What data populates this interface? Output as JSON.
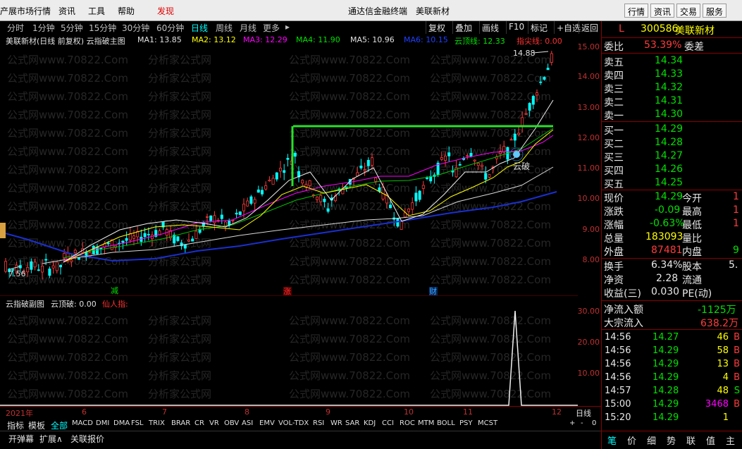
{
  "menubar": {
    "items": [
      "产展市场行情",
      "资讯",
      "工具",
      "帮助",
      "发现"
    ],
    "center_title": "通达信金融终端",
    "center_stock": "美联新材",
    "right_buttons": [
      "行情",
      "资讯",
      "交易",
      "服务"
    ]
  },
  "periods": [
    "分时",
    "1分钟",
    "5分钟",
    "15分钟",
    "30分钟",
    "60分钟",
    "日线",
    "周线",
    "月线",
    "更多"
  ],
  "active_period": "日线",
  "tools": [
    "复权",
    "叠加",
    "画线",
    "F10",
    "标记",
    "+自选",
    "返回"
  ],
  "info": {
    "title": "美联新材(日线 前复权)  云指破主图",
    "ma1": "MA1: 13.85",
    "ma2": "MA2: 13.12",
    "ma3": "MA3: 12.29",
    "ma4": "MA4: 11.90",
    "ma5": "MA5: 10.96",
    "ma6": "MA6: 10.15",
    "cloud": "云顶线: 12.33",
    "tip": "指尖线: 0.00"
  },
  "watermark": [
    "公式网www.70822.Com",
    "分析家公式网",
    "公式网www.70822.Com"
  ],
  "chart_annotations": {
    "high_label": "14.88",
    "low_label": "7.56",
    "cloud_break": "云破",
    "marker_jian": "减",
    "marker_zhang": "涨",
    "marker_cai": "财"
  },
  "yaxis": [
    "15.00",
    "14.00",
    "13.00",
    "12.00",
    "11.00",
    "10.00",
    "9.00",
    "8.00"
  ],
  "sub": {
    "title": "云指破副图",
    "value": "云顶破: 0.00",
    "fairy": "仙人指:"
  },
  "sub_yaxis": [
    "30.00",
    "20.00",
    "10.00"
  ],
  "xaxis": {
    "year": "2021年",
    "months": [
      "6",
      "7",
      "8",
      "9",
      "10",
      "11",
      "12"
    ],
    "mode": "日线"
  },
  "indicator_tabs": [
    "指标",
    "模板",
    "全部",
    "MACD",
    "DMI",
    "DMA",
    "FSL",
    "TRIX",
    "BRAR",
    "CR",
    "VR",
    "OBV",
    "ASI",
    "EMV",
    "VOL-TDX",
    "RSI",
    "WR",
    "SAR",
    "KDJ",
    "CCI",
    "ROC",
    "MTM",
    "BOLL",
    "PSY",
    "MCST"
  ],
  "bottom_tabs": [
    "开弹幕",
    "扩展∧",
    "关联报价"
  ],
  "quote": {
    "code": "300586",
    "name": "美联新材",
    "mark": "L",
    "wb_label": "委比",
    "wb_val": "53.39%",
    "wc_label": "委差",
    "wc_val": "",
    "sells": [
      {
        "l": "卖五",
        "p": "14.34"
      },
      {
        "l": "卖四",
        "p": "14.33"
      },
      {
        "l": "卖三",
        "p": "14.32"
      },
      {
        "l": "卖二",
        "p": "14.31"
      },
      {
        "l": "卖一",
        "p": "14.30"
      }
    ],
    "buys": [
      {
        "l": "买一",
        "p": "14.29"
      },
      {
        "l": "买二",
        "p": "14.28"
      },
      {
        "l": "买三",
        "p": "14.27"
      },
      {
        "l": "买四",
        "p": "14.26"
      },
      {
        "l": "买五",
        "p": "14.25"
      }
    ],
    "price_l": "现价",
    "price": "14.29",
    "open_l": "今开",
    "open": "1",
    "chg_l": "涨跌",
    "chg": "-0.09",
    "high_l": "最高",
    "high": "1",
    "pct_l": "涨幅",
    "pct": "-0.63%",
    "low_l": "最低",
    "low": "1",
    "vol_l": "总量",
    "vol": "183093",
    "vr_l": "量比",
    "vr": "",
    "out_l": "外盘",
    "out": "87481",
    "in_l": "内盘",
    "in": "9",
    "turn_l": "换手",
    "turn": "6.34%",
    "cap_l": "股本",
    "cap": "5.",
    "na_l": "净资",
    "na": "2.28",
    "flow_l": "流通",
    "flow": "",
    "eps_l": "收益(三)",
    "eps": "0.030",
    "pe_l": "PE(动)",
    "pe": "",
    "net_in_l": "净流入额",
    "net_in": "-1125万",
    "block_l": "大宗流入",
    "block": "638.2万"
  },
  "ticks": [
    {
      "t": "14:56",
      "p": "14.27",
      "v": "46",
      "d": "B"
    },
    {
      "t": "14:56",
      "p": "14.29",
      "v": "58",
      "d": "B"
    },
    {
      "t": "14:56",
      "p": "14.29",
      "v": "13",
      "d": "B"
    },
    {
      "t": "14:56",
      "p": "14.29",
      "v": "4",
      "d": "B"
    },
    {
      "t": "14:57",
      "p": "14.28",
      "v": "48",
      "d": "S"
    },
    {
      "t": "15:00",
      "p": "14.29",
      "v": "3468",
      "d": "B"
    },
    {
      "t": "15:20",
      "p": "14.29",
      "v": "1",
      "d": ""
    }
  ],
  "right_tabs": [
    "笔",
    "价",
    "细",
    "势",
    "联",
    "值",
    "主"
  ]
}
